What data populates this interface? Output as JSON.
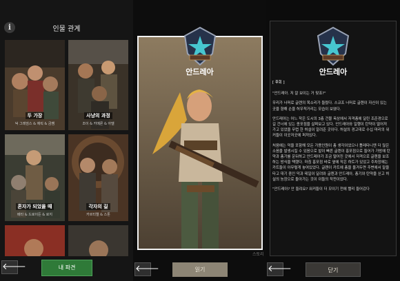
{
  "left_panel": {
    "title": "인물 관계",
    "info_icon": "ⅰ",
    "cards": [
      {
        "name": "두 가장",
        "subtitle": "덕 그레엄스 & 에릭 & 금쌤"
      },
      {
        "name": "사냥의 과정",
        "subtitle": "조이 & 카메론 & 아델"
      },
      {
        "name": "혼자가 되었을 때",
        "subtitle": "베타 & 드로이든 & 로지"
      },
      {
        "name": "각자의 길",
        "subtitle": "카르티엘 & 스톤"
      },
      {
        "name": "",
        "subtitle": ""
      },
      {
        "name": "",
        "subtitle": ""
      }
    ],
    "back_label": "🡐",
    "primary_button": "내 파견"
  },
  "middle_panel": {
    "character_name": "안드레아",
    "read_button": "읽기",
    "back_label": "🡐",
    "tiny_label": "스토리"
  },
  "right_panel": {
    "character_name": "안드레아",
    "section": "[ 후회 ]",
    "paragraphs": [
      "\"안드레아. 저 잘 보이는 거 맞죠?\"",
      "우리가 너머로 글렌의 목소리가 들렸다. 스코프 너머로 글렌이 자신이 있는 곳을 향해 손을 허우적거리는 모습이 보였다.",
      "안드레아는 어느 작은 도시의 3층 건물 옥상에서 저격총에 달린 조준경으로 길 건너에 있는 종포점을 살펴보고 있다. 안드레아와 일행이 탄약이 떨어져 가고 있었을 무렵 한 허설이 알려준 곳이다. 허설의 경고대로 수십 마리의 워커들이 이곳저곳에 퍼져있다.",
      "처음에는 덕을 포함해 모든 가용인원이 총 생각이었으나 틀레타니엔 더 많은 소음을 발생시킬 수 있음으로 발이 빠른 글렌이 홍포점으로 들어가 가방에 탄약과 총기를 운뒤하고 안드레아가 조금 떨어진 곳에서 저격으로 글렌을 보조하는 방식을 택했다. 마침 홍포점 바로 옆에 작은 하트가 있었고 주차장에는 카트들이 아무렇게 놓여있었다. 글렌이 카트에 총을 올겨두면 주변에서 말을 타고 대기 중인 덕과 테일이 달려와 글렌과 안드레아, 총기와 탄약을 싣고 허설의 농장으로 돌아가는 것이 이들의 작전이었다.",
      "\"안드레아? 안 들려요? 워커들이 더 모이기 전에 빨리 들어갔다"
    ],
    "back_label": "🡐",
    "close_button": "닫기"
  },
  "colors": {
    "accent_green": "#2f7a38",
    "emblem_teal": "#47c6d0"
  }
}
